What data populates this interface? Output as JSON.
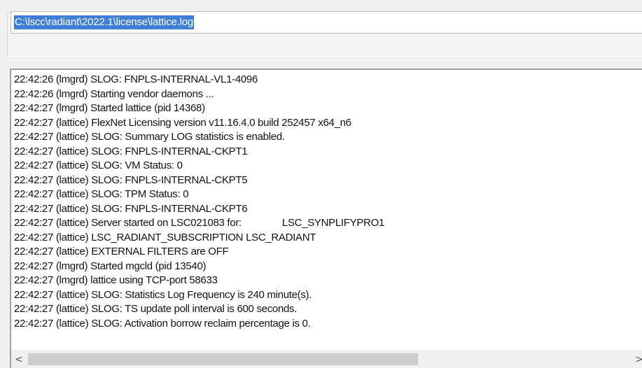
{
  "path_field": {
    "value": "C:\\lscc\\radiant\\2022.1\\license\\lattice.log"
  },
  "log": {
    "lines": [
      "22:42:26 (lmgrd) SLOG: FNPLS-INTERNAL-VL1-4096",
      "22:42:26 (lmgrd) Starting vendor daemons ...",
      "22:42:27 (lmgrd) Started lattice (pid 14368)",
      "22:42:27 (lattice) FlexNet Licensing version v11.16.4.0 build 252457 x64_n6",
      "22:42:27 (lattice) SLOG: Summary LOG statistics is enabled.",
      "22:42:27 (lattice) SLOG: FNPLS-INTERNAL-CKPT1",
      "22:42:27 (lattice) SLOG: VM Status: 0",
      "22:42:27 (lattice) SLOG: FNPLS-INTERNAL-CKPT5",
      "22:42:27 (lattice) SLOG: TPM Status: 0",
      "22:42:27 (lattice) SLOG: FNPLS-INTERNAL-CKPT6",
      "22:42:27 (lattice) Server started on LSC021083 for:               LSC_SYNPLIFYPRO1",
      "22:42:27 (lattice) LSC_RADIANT_SUBSCRIPTION LSC_RADIANT",
      "22:42:27 (lattice) EXTERNAL FILTERS are OFF",
      "22:42:27 (lmgrd) Started mgcld (pid 13540)",
      "22:42:27 (lmgrd) lattice using TCP-port 58633",
      "22:42:27 (lattice) SLOG: Statistics Log Frequency is 240 minute(s).",
      "22:42:27 (lattice) SLOG: TS update poll interval is 600 seconds.",
      "22:42:27 (lattice) SLOG: Activation borrow reclaim percentage is 0."
    ]
  },
  "scrollbar": {
    "left_arrow": "<",
    "right_arrow": ">"
  },
  "colors": {
    "selection": "#3f7ed8",
    "window_bg": "#f0f0f0",
    "thumb": "#cdcdcd"
  }
}
